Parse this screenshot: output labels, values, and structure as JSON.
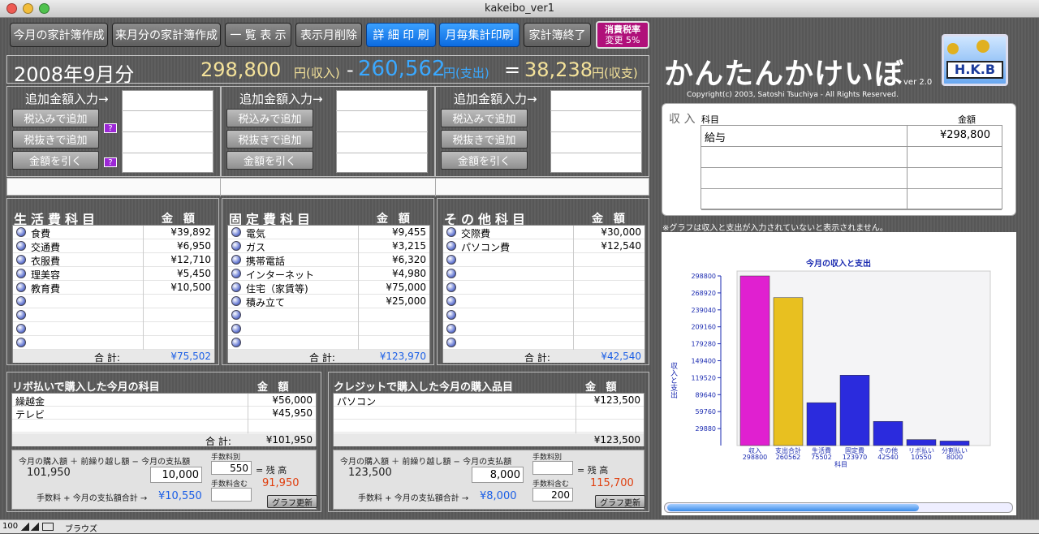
{
  "window": {
    "title": "kakeibo_ver1"
  },
  "toolbar": {
    "b1": "今月の家計簿作成",
    "b2": "来月分の家計簿作成",
    "b3": "一 覧 表 示",
    "b4": "表示月削除",
    "b5": "詳 細 印 刷",
    "b6": "月毎集計印刷",
    "b7": "家計簿終了",
    "tax1": "消費税率",
    "tax2": "変更 5%"
  },
  "summary": {
    "month": "2008年9月分",
    "income": "298,800",
    "income_unit": "円(収入)",
    "minus": "-",
    "expense": "260,562",
    "expense_unit": "円(支出)",
    "eq": "=",
    "balance": "38,238",
    "balance_unit": "円(収支)"
  },
  "entry": {
    "label": "追加金額入力→",
    "btn_tax_in": "税込みで追加",
    "btn_tax_out": "税抜きで追加",
    "btn_sub": "金額を引く",
    "help": "?"
  },
  "app": {
    "title": "かんたんかけいぼ",
    "ver": "ver 2.0",
    "copyright": "Copyright(c) 2003, Satoshi Tsuchiya - All Rights Reserved.",
    "logo": "H.K.B"
  },
  "income": {
    "label": "収 入",
    "col_item": "科目",
    "col_amount": "金額",
    "rows": [
      {
        "item": "給与",
        "amount": "¥298,800"
      },
      {
        "item": "",
        "amount": ""
      },
      {
        "item": "",
        "amount": ""
      },
      {
        "item": "",
        "amount": ""
      }
    ]
  },
  "note": "※グラフは収入と支出が入力されていないと表示されません。",
  "living": {
    "header": "生活費科目",
    "amount_header": "金 額",
    "rows": [
      {
        "item": "食費",
        "amount": "¥39,892"
      },
      {
        "item": "交通費",
        "amount": "¥6,950"
      },
      {
        "item": "衣服費",
        "amount": "¥12,710"
      },
      {
        "item": "理美容",
        "amount": "¥5,450"
      },
      {
        "item": "教育費",
        "amount": "¥10,500"
      },
      {
        "item": "",
        "amount": ""
      },
      {
        "item": "",
        "amount": ""
      },
      {
        "item": "",
        "amount": ""
      },
      {
        "item": "",
        "amount": ""
      }
    ],
    "total_label": "合 計:",
    "total": "¥75,502"
  },
  "fixed": {
    "header": "固定費科目",
    "amount_header": "金 額",
    "rows": [
      {
        "item": "電気",
        "amount": "¥9,455"
      },
      {
        "item": "ガス",
        "amount": "¥3,215"
      },
      {
        "item": "携帯電話",
        "amount": "¥6,320"
      },
      {
        "item": "インターネット",
        "amount": "¥4,980"
      },
      {
        "item": "住宅（家賃等)",
        "amount": "¥75,000"
      },
      {
        "item": "積み立て",
        "amount": "¥25,000"
      },
      {
        "item": "",
        "amount": ""
      },
      {
        "item": "",
        "amount": ""
      },
      {
        "item": "",
        "amount": ""
      }
    ],
    "total_label": "合 計:",
    "total": "¥123,970"
  },
  "other": {
    "header": "その他科目",
    "amount_header": "金 額",
    "rows": [
      {
        "item": "交際費",
        "amount": "¥30,000"
      },
      {
        "item": "パソコン費",
        "amount": "¥12,540"
      },
      {
        "item": "",
        "amount": ""
      },
      {
        "item": "",
        "amount": ""
      },
      {
        "item": "",
        "amount": ""
      },
      {
        "item": "",
        "amount": ""
      },
      {
        "item": "",
        "amount": ""
      },
      {
        "item": "",
        "amount": ""
      },
      {
        "item": "",
        "amount": ""
      }
    ],
    "total_label": "合 計:",
    "total": "¥42,540"
  },
  "revolving": {
    "header": "リボ払いで購入した今月の科目",
    "amount_header": "金 額",
    "rows": [
      {
        "item": "繰越金",
        "amount": "¥56,000"
      },
      {
        "item": "テレビ",
        "amount": "¥45,950"
      },
      {
        "item": "",
        "amount": ""
      }
    ],
    "total_label": "合 計:",
    "total": "¥101,950",
    "calc_header": "今月の購入額 ＋ 前繰り越し額 − 今月の支払額",
    "purchase": "101,950",
    "payment": "10,000",
    "fee_label": "手数料別",
    "fee": "550",
    "eq": "= 残 高",
    "fee_incl_label": "手数料含む",
    "fee_incl": "",
    "balance": "91,950",
    "sum_label": "手数料 + 今月の支払額合計 →",
    "sum": "¥10,550",
    "graph_btn": "グラフ更新"
  },
  "credit": {
    "header": "クレジットで購入した今月の購入品目",
    "amount_header": "金 額",
    "rows": [
      {
        "item": "パソコン",
        "amount": "¥123,500"
      },
      {
        "item": "",
        "amount": ""
      },
      {
        "item": "",
        "amount": ""
      }
    ],
    "total": "¥123,500",
    "calc_header": "今月の購入額 ＋ 前繰り越し額 − 今月の支払額",
    "purchase": "123,500",
    "payment": "8,000",
    "fee_label": "手数料別",
    "fee": "",
    "eq": "= 残 高",
    "fee_incl_label": "手数料含む",
    "fee_incl": "200",
    "balance": "115,700",
    "sum_label": "手数料 + 今月の支払額合計 →",
    "sum": "¥8,000",
    "graph_btn": "グラフ更新"
  },
  "statusbar": {
    "zoom": "100",
    "mode": "ブラウズ"
  },
  "chart_data": {
    "type": "bar",
    "title": "今月の収入と支出",
    "ylabel": "収入と支出",
    "xlabel": "科目",
    "ylim": [
      0,
      298800
    ],
    "yticks": [
      29880,
      59760,
      89640,
      119520,
      149400,
      179280,
      209160,
      239040,
      268920,
      298800
    ],
    "categories": [
      "収入",
      "支出合計",
      "生活費",
      "固定費",
      "その他",
      "リボ払い",
      "分割払い"
    ],
    "values": [
      298800,
      260562,
      75502,
      123970,
      42540,
      10550,
      8000
    ],
    "colors": [
      "#e020d0",
      "#e8c020",
      "#2b2bdd",
      "#2b2bdd",
      "#2b2bdd",
      "#2b2bdd",
      "#2b2bdd"
    ]
  }
}
